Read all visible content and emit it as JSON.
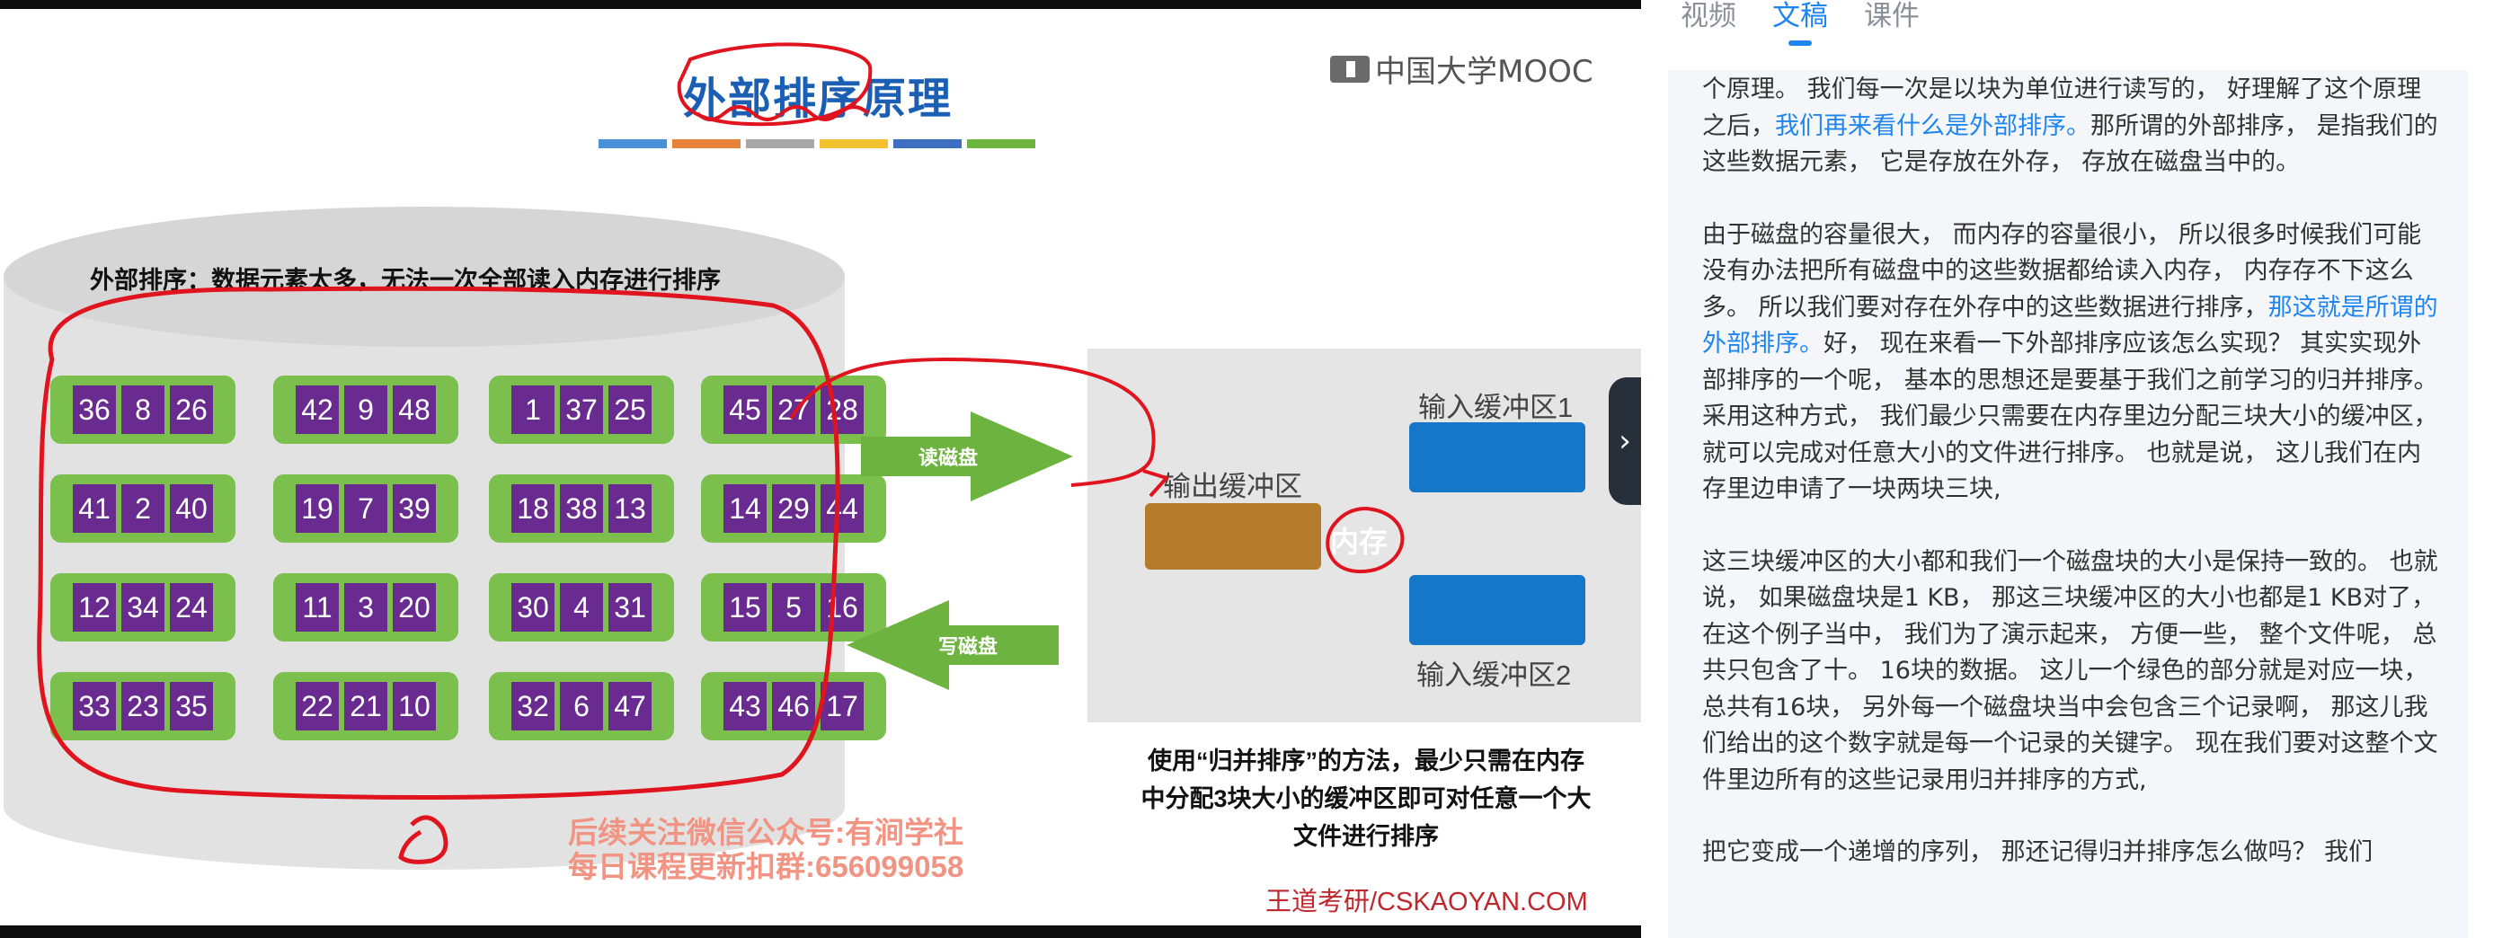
{
  "slide": {
    "title_a": "外部排序",
    "title_b": "原理",
    "brand": "中国大学MOOC",
    "bar_colors": [
      "#4a90d9",
      "#e8833a",
      "#a7a7a7",
      "#f2c12e",
      "#3e6fc2",
      "#6db33f"
    ],
    "disk_caption": "外部排序：数据元素太多，无法一次全部读入内存进行排序",
    "blocks": [
      [
        "36",
        "8",
        "26"
      ],
      [
        "42",
        "9",
        "48"
      ],
      [
        "1",
        "37",
        "25"
      ],
      [
        "45",
        "27",
        "28"
      ],
      [
        "41",
        "2",
        "40"
      ],
      [
        "19",
        "7",
        "39"
      ],
      [
        "18",
        "38",
        "13"
      ],
      [
        "14",
        "29",
        "44"
      ],
      [
        "12",
        "34",
        "24"
      ],
      [
        "11",
        "3",
        "20"
      ],
      [
        "30",
        "4",
        "31"
      ],
      [
        "15",
        "5",
        "16"
      ],
      [
        "33",
        "23",
        "35"
      ],
      [
        "22",
        "21",
        "10"
      ],
      [
        "32",
        "6",
        "47"
      ],
      [
        "43",
        "46",
        "17"
      ]
    ],
    "read_label": "读磁盘",
    "write_label": "写磁盘",
    "output_buffer": "输出缓冲区",
    "input_buffer_1": "输入缓冲区1",
    "input_buffer_2": "输入缓冲区2",
    "memory_label": "内存",
    "text_lines": [
      "使用“归并排序”的方法，最少只需在内存",
      "中分配3块大小的缓冲区即可对任意一个大",
      "文件进行排序"
    ],
    "watermark_1": "后续关注微信公众号:有涧学社",
    "watermark_2": "每日课程更新扣群:656099058",
    "credit": "王道考研/CSKAOYAN.COM",
    "next_icon": "chevron-right-icon"
  },
  "panel": {
    "tabs": [
      "视频",
      "文稿",
      "课件"
    ],
    "active_tab": "文稿",
    "para1_a": "个原理。 我们每一次是以块为单位进行读写的， 好理解了这个原理之后，",
    "para1_hl": "我们再来看什么是外部排序。",
    "para1_b": "那所谓的外部排序， 是指我们的这些数据元素， 它是存放在外存， 存放在磁盘当中的。",
    "para2_a": "由于磁盘的容量很大， 而内存的容量很小， 所以很多时候我们可能没有办法把所有磁盘中的这些数据都给读入内存， 内存存不下这么多。 所以我们要对存在外存中的这些数据进行排序，",
    "para2_hl": "那这就是所谓的外部排序。",
    "para2_b": "好， 现在来看一下外部排序应该怎么实现？ 其实实现外部排序的一个呢， 基本的思想还是要基于我们之前学习的归并排序。 采用这种方式， 我们最少只需要在内存里边分配三块大小的缓冲区， 就可以完成对任意大小的文件进行排序。 也就是说， 这儿我们在内存里边申请了一块两块三块,",
    "para3": "这三块缓冲区的大小都和我们一个磁盘块的大小是保持一致的。 也就说， 如果磁盘块是1 KB， 那这三块缓冲区的大小也都是1 KB对了， 在这个例子当中， 我们为了演示起来， 方便一些， 整个文件呢， 总共只包含了十。 16块的数据。 这儿一个绿色的部分就是对应一块， 总共有16块， 另外每一个磁盘块当中会包含三个记录啊， 那这儿我们给出的这个数字就是每一个记录的关键字。 现在我们要对这整个文件里边所有的这些记录用归并排序的方式,",
    "para4": "把它变成一个递增的序列， 那还记得归并排序怎么做吗？ 我们"
  }
}
